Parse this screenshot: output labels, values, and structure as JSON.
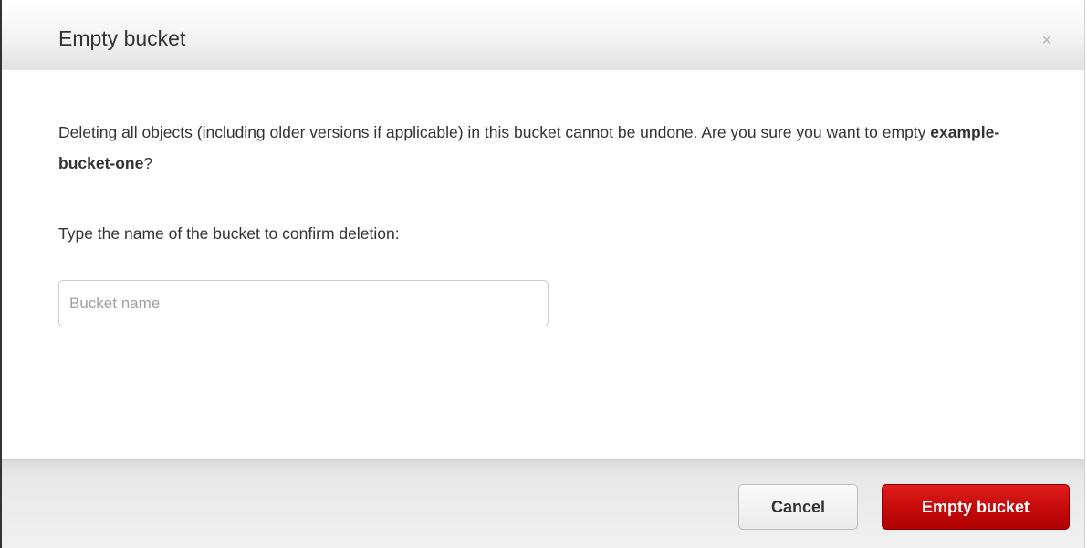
{
  "dialog": {
    "title": "Empty bucket",
    "close_glyph": "×",
    "message_before": "Deleting all objects (including older versions if applicable) in this bucket cannot be undone. Are you sure you want to empty ",
    "bucket_name": "example-bucket-one",
    "message_after": "?",
    "confirm_prompt": "Type the name of the bucket to confirm deletion:",
    "input": {
      "placeholder": "Bucket name",
      "value": ""
    },
    "cancel_label": "Cancel",
    "confirm_label": "Empty bucket"
  },
  "icons": {
    "close": "close-icon"
  },
  "colors": {
    "danger": "#c40a0a",
    "text": "#333333"
  }
}
